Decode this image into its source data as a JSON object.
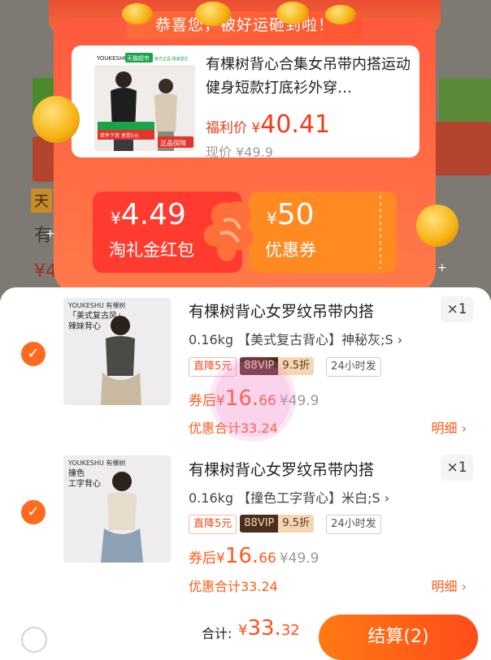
{
  "background_page": {
    "partial_text": "有",
    "partial_price": "¥4",
    "partial_tag": "天"
  },
  "popup": {
    "banner": "恭喜您，被好运砸到啦！",
    "product": {
      "image_brand": "YOUKESHU",
      "image_store": "天猫超市",
      "image_store_note": "官方正品 极速送达",
      "image_promo": "单件下单 享受5元",
      "image_badge": "正品保障",
      "title": "有棵树背心合集女吊带内搭运动健身短款打底衫外穿…",
      "welfare_label": "福利价",
      "welfare_symbol": "¥",
      "welfare_price": "40.41",
      "current_label": "现价",
      "current_price": "¥49.9"
    },
    "coupon_redpacket": {
      "symbol": "¥",
      "amount": "4.49",
      "label": "淘礼金红包"
    },
    "coupon_voucher": {
      "symbol": "¥",
      "amount": "50",
      "label": "优惠券"
    }
  },
  "cart": {
    "items": [
      {
        "checked": true,
        "thumb_brand": "YOUKESHU 有棵树",
        "thumb_tag_1": "「美式复古风」",
        "thumb_tag_2": "辣妹背心",
        "title": "有棵树背心女罗纹吊带内搭",
        "qty": "×1",
        "sku": "0.16kg 【美式复古背心】神秘灰;S",
        "tags": {
          "discount": "直降5元",
          "vip": "88VIP",
          "vip_rate": "9.5折",
          "ship": "24小时发"
        },
        "after_label": "券后",
        "after_symbol": "¥",
        "after_int": "16.",
        "after_dec": "66",
        "orig_price": "¥49.9",
        "total_text": "优惠合计33.24",
        "detail": "明细 ›"
      },
      {
        "checked": true,
        "thumb_brand": "YOUKESHU 有棵树",
        "thumb_tag_1": "撞色",
        "thumb_tag_2": "工字背心",
        "title": "有棵树背心女罗纹吊带内搭",
        "qty": "×1",
        "sku": "0.16kg 【撞色工字背心】米白;S",
        "tags": {
          "discount": "直降5元",
          "vip": "88VIP",
          "vip_rate": "9.5折",
          "ship": "24小时发"
        },
        "after_label": "券后",
        "after_symbol": "¥",
        "after_int": "16.",
        "after_dec": "66",
        "orig_price": "¥49.9",
        "total_text": "优惠合计33.24",
        "detail": "明细 ›"
      }
    ],
    "footer": {
      "total_label": "合计:",
      "total_symbol": "¥",
      "total_int": "33.",
      "total_dec": "32",
      "checkout": "结算(2)"
    }
  },
  "colors": {
    "accent": "#ff5b1a",
    "red_coupon": "#ff3b2f",
    "orange_coupon": "#ff8a22",
    "vip_dark": "#4a2e1e"
  }
}
